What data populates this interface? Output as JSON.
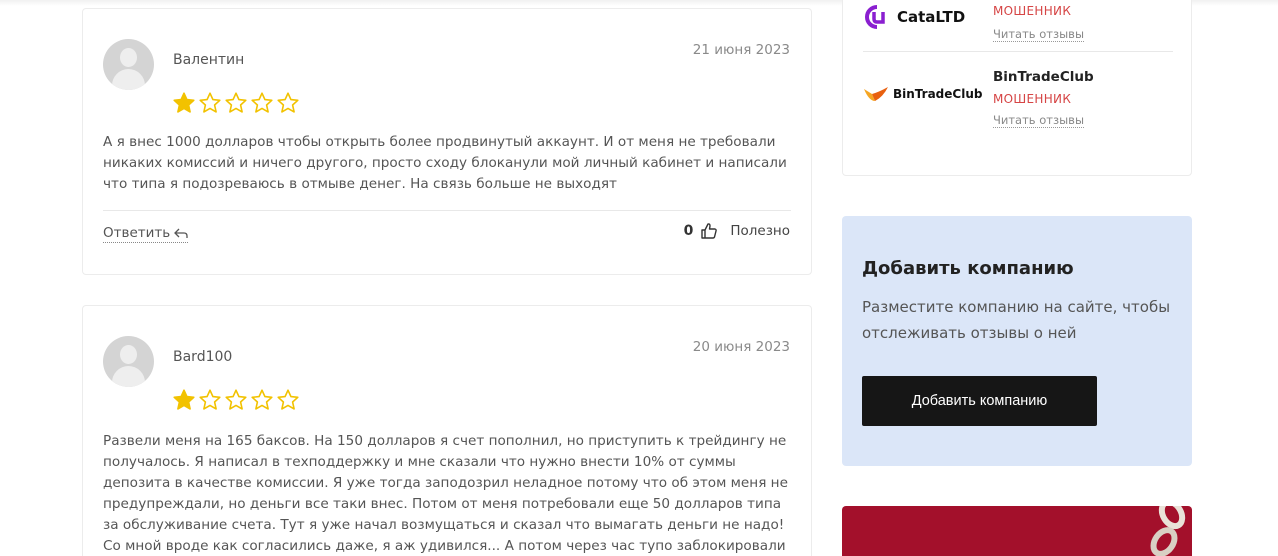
{
  "reviews": [
    {
      "author": "Валентин",
      "date": "21 июня 2023",
      "rating": 1,
      "max_rating": 5,
      "text": "А я внес 1000 долларов чтобы открыть более продвинутый аккаунт. И от меня не требовали никаких комиссий и ничего другого, просто сходу блоканули мой личный кабинет и написали что типа я подозреваюсь в отмыве денег. На связь больше не выходят",
      "reply_label": "Ответить",
      "helpful_count": "0",
      "helpful_label": "Полезно"
    },
    {
      "author": "Bard100",
      "date": "20 июня 2023",
      "rating": 1,
      "max_rating": 5,
      "text": "Развели меня на 165 баксов. На 150 долларов я счет пополнил, но приступить к трейдингу не получалось. Я написал в техподдержку и мне сказали что нужно внести 10% от суммы депозита в качестве комиссии. Я уже тогда заподозрил неладное потому что об этом меня не предупреждали, но деньги все таки внес. Потом от меня потребовали еще 50 долларов типа за обслуживание счета. Тут я уже начал возмущаться и сказал что вымагать деньги не надо! Со мной вроде как согласились даже, я аж удивился... А потом через час тупо заблокировали"
    }
  ],
  "companies": [
    {
      "logo_text": "CataLTD",
      "status": "МОШЕННИК",
      "link": "Читать отзывы",
      "logo_color": "#8a1fd0"
    },
    {
      "name": "BinTradeClub",
      "logo_text": "BinTradeClub",
      "status": "МОШЕННИК",
      "link": "Читать отзывы",
      "logo_color": "#f08a12"
    }
  ],
  "add_company": {
    "title": "Добавить компанию",
    "description": "Разместите компанию на сайте, чтобы отслеживать отзывы о ней",
    "button_label": "Добавить компанию"
  },
  "colors": {
    "star": "#f2c200",
    "scam": "#d64545",
    "add_box_bg": "#dbe6f8",
    "banner": "#a3102b"
  }
}
